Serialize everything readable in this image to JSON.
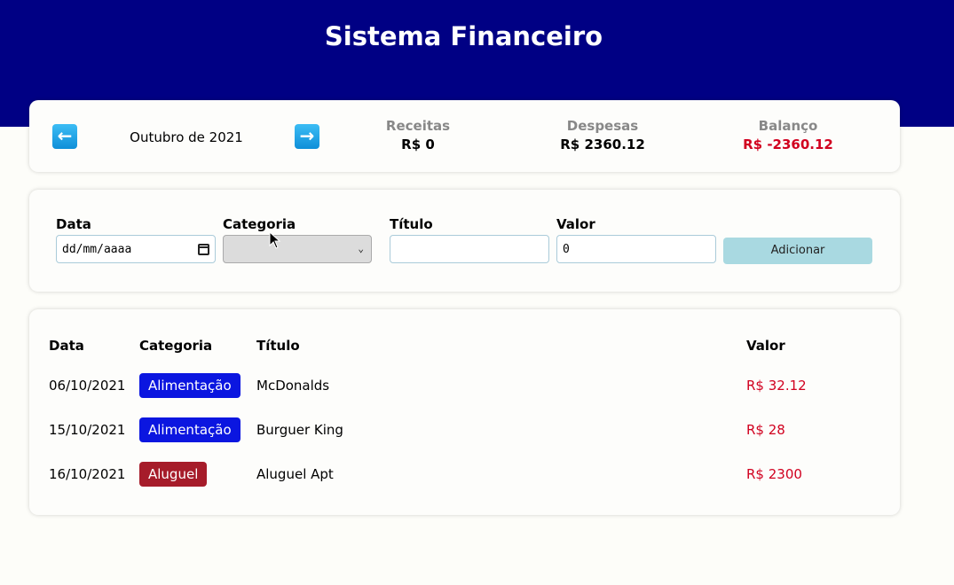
{
  "header": {
    "title": "Sistema Financeiro"
  },
  "info": {
    "prev_icon": "left-arrow-icon",
    "next_icon": "right-arrow-icon",
    "month": "Outubro de 2021",
    "receitas": {
      "title": "Receitas",
      "value": "R$ 0"
    },
    "despesas": {
      "title": "Despesas",
      "value": "R$ 2360.12"
    },
    "balanco": {
      "title": "Balanço",
      "value": "R$ -2360.12",
      "color": "#d1001f"
    }
  },
  "form": {
    "date": {
      "label": "Data",
      "placeholder": "dd/mm/aaaa"
    },
    "category": {
      "label": "Categoria",
      "value": ""
    },
    "title": {
      "label": "Título",
      "value": ""
    },
    "value": {
      "label": "Valor",
      "value": "0"
    },
    "add_label": "Adicionar"
  },
  "table": {
    "headers": {
      "date": "Data",
      "category": "Categoria",
      "title": "Título",
      "value": "Valor"
    },
    "rows": [
      {
        "date": "06/10/2021",
        "category": "Alimentação",
        "category_color": "#0b16e0",
        "title": "McDonalds",
        "value": "R$ 32.12"
      },
      {
        "date": "15/10/2021",
        "category": "Alimentação",
        "category_color": "#0b16e0",
        "title": "Burguer King",
        "value": "R$ 28"
      },
      {
        "date": "16/10/2021",
        "category": "Aluguel",
        "category_color": "#a61c2a",
        "title": "Aluguel Apt",
        "value": "R$ 2300"
      }
    ]
  },
  "colors": {
    "header_bg": "#000084",
    "negative": "#d1001f",
    "button_bg": "#a9d9e1"
  }
}
